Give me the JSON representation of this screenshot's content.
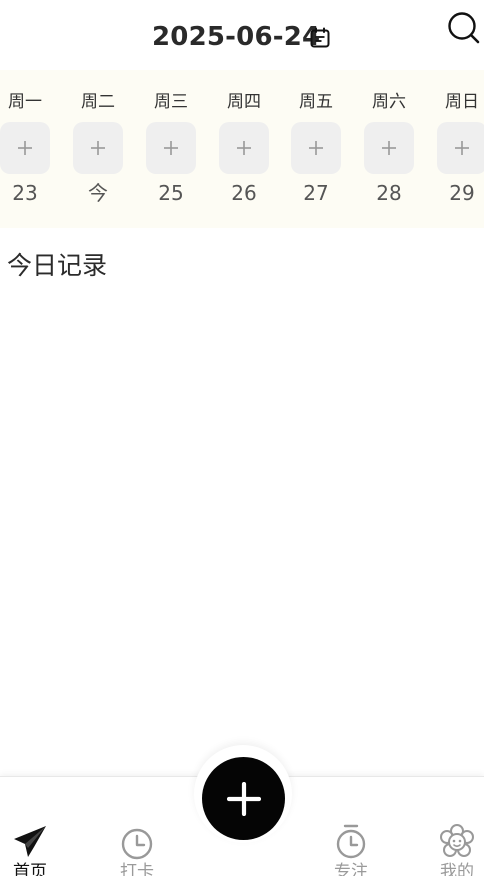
{
  "header": {
    "date": "2025-06-24",
    "calendar_icon": "calendar-icon",
    "search_icon": "search-icon"
  },
  "week": {
    "days": [
      {
        "label": "周一",
        "number": "23"
      },
      {
        "label": "周二",
        "number": "今"
      },
      {
        "label": "周三",
        "number": "25"
      },
      {
        "label": "周四",
        "number": "26"
      },
      {
        "label": "周五",
        "number": "27"
      },
      {
        "label": "周六",
        "number": "28"
      },
      {
        "label": "周日",
        "number": "29"
      }
    ],
    "add_icon": "plus-icon"
  },
  "main": {
    "section_title": "今日记录"
  },
  "bottom_nav": {
    "items": [
      {
        "label": "首页",
        "icon": "paper-plane-icon",
        "active": true
      },
      {
        "label": "打卡",
        "icon": "clock-icon",
        "active": false
      },
      {
        "label": "专注",
        "icon": "timer-icon",
        "active": false
      },
      {
        "label": "我的",
        "icon": "flower-icon",
        "active": false
      }
    ],
    "fab_icon": "plus-icon"
  },
  "colors": {
    "week_strip_bg": "#fdfcf4",
    "day_button_bg": "#efefef",
    "fab_bg": "#050505",
    "nav_active": "#111111",
    "nav_inactive": "#9a9a9a"
  }
}
